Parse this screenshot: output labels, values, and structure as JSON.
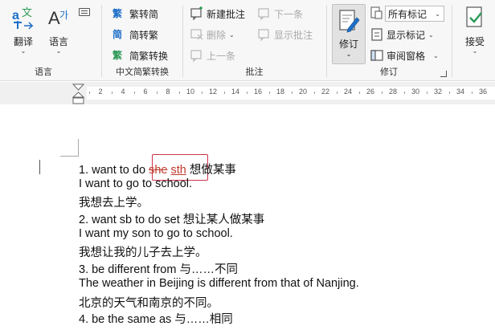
{
  "ribbon": {
    "language": {
      "translate": "翻译",
      "language": "语言",
      "label": "语言"
    },
    "chinese": {
      "to_traditional": "繁转简",
      "to_simplified": "简转繁",
      "convert": "简繁转换",
      "label": "中文简繁转换"
    },
    "comments": {
      "new": "新建批注",
      "next": "下一条",
      "delete": "删除",
      "show": "显示批注",
      "prev": "上一条",
      "label": "批注"
    },
    "tracking": {
      "revise": "修订",
      "markup_select": "所有标记",
      "show_markup": "显示标记",
      "review_pane": "审阅窗格",
      "label": "修订"
    },
    "accept": "接受"
  },
  "ruler_ticks": [
    "2",
    "4",
    "6",
    "8",
    "10",
    "12",
    "14",
    "16",
    "18",
    "20",
    "22",
    "24",
    "26",
    "28",
    "30",
    "32",
    "34",
    "36"
  ],
  "document": {
    "line1_prefix": "1. want to do ",
    "line1_deleted": "she",
    "line1_inserted": "sth",
    "line1_suffix": " 想做某事",
    "line2": "I want to go to school.",
    "line3": "我想去上学。",
    "line4": "2. want sb to do set  想让某人做某事",
    "line5": "I want my son to go to school.",
    "line6": "我想让我的儿子去上学。",
    "line7": "3. be different from  与……不同",
    "line8": "The weather in Beijing is different from that of Nanjing.",
    "line9": "北京的天气和南京的不同。",
    "line10": "4. be the same as  与……相同"
  },
  "colors": {
    "accent_blue": "#1e6fc8",
    "revision_red": "#c0392b"
  }
}
